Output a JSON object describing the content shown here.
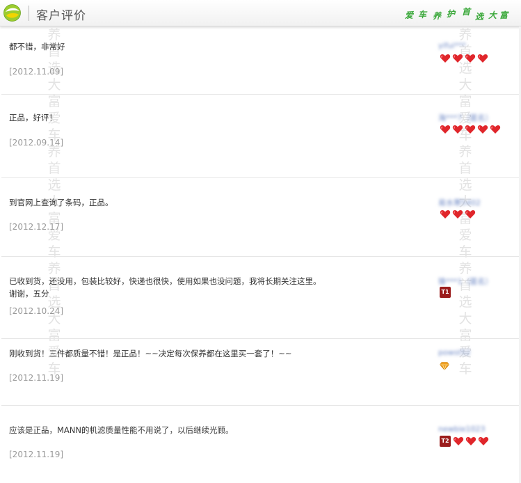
{
  "header": {
    "title": "客户评价",
    "slogan": [
      "爱",
      "车",
      "养",
      "护",
      "首",
      "选",
      "大",
      "富"
    ]
  },
  "watermark_text": "养首选大富爱车养首选大富爱车养首选大富爱车",
  "reviews": [
    {
      "comment": "都不错，非常好",
      "date": "[2012.11.09]",
      "user": "yifui***",
      "hearts": 4,
      "badge": "",
      "diamond": false
    },
    {
      "comment": "正品，好评！",
      "date": "[2012.09.14]",
      "user": "海***7（匿名）",
      "hearts": 5,
      "badge": "",
      "diamond": false
    },
    {
      "comment": "到官网上查询了条码，正品。",
      "date": "[2012.12.17]",
      "user": "易水寒5402",
      "hearts": 3,
      "badge": "",
      "diamond": false
    },
    {
      "comment": "已收到货，还没用，包装比较好，快递也很快，使用如果也没问题，我将长期关注这里。谢谢，五分",
      "date": "[2012.10.24]",
      "user": "锋***1（匿名）",
      "hearts": 0,
      "badge": "T1",
      "diamond": false
    },
    {
      "comment": "刚收到货！三件都质量不错！是正品！~~决定每次保养都在这里买一套了！~~",
      "date": "[2012.11.19]",
      "user": "powst52",
      "hearts": 0,
      "badge": "",
      "diamond": true
    },
    {
      "comment": "应该是正品，MANN的机滤质量性能不用说了，以后继续光顾。",
      "date": "[2012.11.19]",
      "user": "newbie1023",
      "hearts": 3,
      "badge": "T2",
      "diamond": false
    }
  ],
  "colors": {
    "heart": "#e0262b",
    "accent_green": "#3aa83a",
    "badge": "#9b1c1c",
    "date": "#999999"
  }
}
